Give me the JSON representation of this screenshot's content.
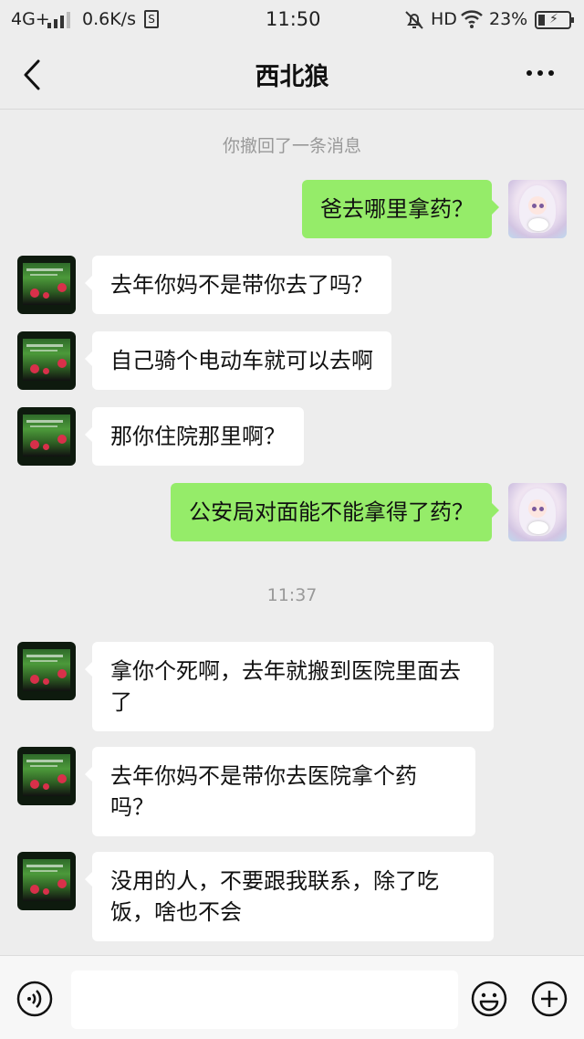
{
  "status_bar": {
    "network": "4G+",
    "speed": "0.6K/s",
    "sd_label": "S",
    "time": "11:50",
    "hd": "HD",
    "battery_pct": "23%",
    "battery_level": 0.23
  },
  "nav": {
    "title": "西北狼"
  },
  "chat": {
    "recall_notice": "你撤回了一条消息",
    "timestamp": "11:37",
    "messages": [
      {
        "side": "right",
        "text": "爸去哪里拿药？"
      },
      {
        "side": "left",
        "text": "去年你妈不是带你去了吗？"
      },
      {
        "side": "left",
        "text": "自己骑个电动车就可以去啊"
      },
      {
        "side": "left",
        "text": "那你住院那里啊？"
      },
      {
        "side": "right",
        "text": "公安局对面能不能拿得了药？"
      },
      {
        "side": "left",
        "text": "拿你个死啊，去年就搬到医院里面去了"
      },
      {
        "side": "left",
        "text": "去年你妈不是带你去医院拿个药吗？"
      },
      {
        "side": "left",
        "text": "没用的人，不要跟我联系，除了吃饭，啥也不会"
      }
    ]
  },
  "input": {
    "placeholder": ""
  },
  "icons": {
    "back": "back-arrow-icon",
    "more": "more-dots-icon",
    "voice": "voice-icon",
    "emoji": "emoji-icon",
    "plus": "plus-icon"
  },
  "colors": {
    "background": "#ededed",
    "bubble_sent": "#95ec69",
    "bubble_received": "#ffffff",
    "system_text": "#999999"
  }
}
